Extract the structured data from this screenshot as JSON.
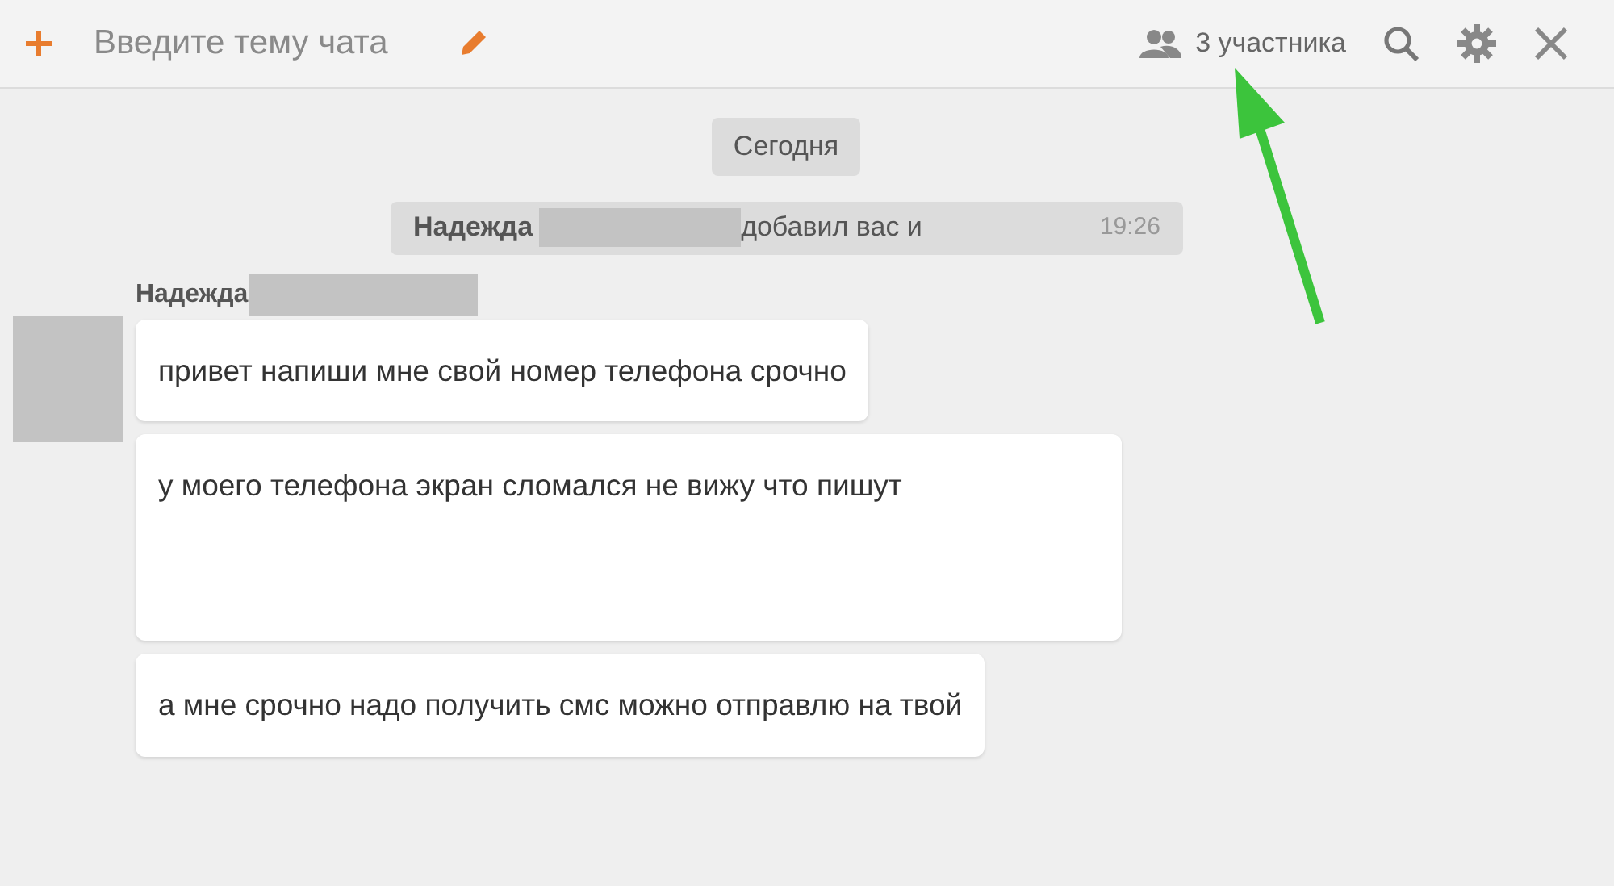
{
  "header": {
    "topic_placeholder": "Введите тему чата",
    "participants": "3 участника"
  },
  "date_separator": "Сегодня",
  "system_message": {
    "author": "Надежда",
    "text": "добавил вас и",
    "time": "19:26"
  },
  "sender": {
    "name": "Надежда"
  },
  "messages": [
    {
      "text": "привет напиши мне свой номер телефона срочно"
    },
    {
      "text": "у моего телефона экран сломался не вижу что пишут"
    },
    {
      "text": "а мне срочно надо получить смс можно отправлю на твой"
    }
  ]
}
